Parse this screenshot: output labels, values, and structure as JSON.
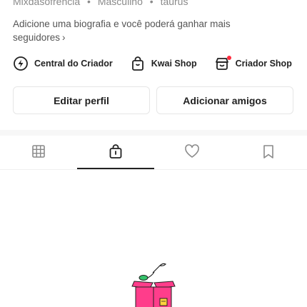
{
  "profile": {
    "username": "Mixdasofrencia",
    "gender": "Masculino",
    "sign": "taurus",
    "separator": "•",
    "bio_line1": "Adicione uma biografia e você poderá ganhar mais",
    "bio_line2": "seguidores",
    "bio_chevron": "›"
  },
  "shortcuts": [
    {
      "label": "Central do Criador",
      "icon": "bulb-icon"
    },
    {
      "label": "Kwai Shop",
      "icon": "shopping-bag-icon"
    },
    {
      "label": "Criador Shop",
      "icon": "creator-shop-icon"
    }
  ],
  "buttons": {
    "edit_label": "Editar perfil",
    "add_label": "Adicionar amigos"
  },
  "tabs": [
    {
      "name": "grid",
      "icon": "grid-icon"
    },
    {
      "name": "shop",
      "icon": "shopping-bag-icon",
      "active": true
    },
    {
      "name": "likes",
      "icon": "heart-icon"
    },
    {
      "name": "saved",
      "icon": "bookmark-icon"
    }
  ],
  "colors": {
    "accent_pink": "#ff3d8b",
    "notification_red": "#ff2b3d",
    "text_primary": "#222222",
    "text_secondary": "#8a8a8a"
  }
}
